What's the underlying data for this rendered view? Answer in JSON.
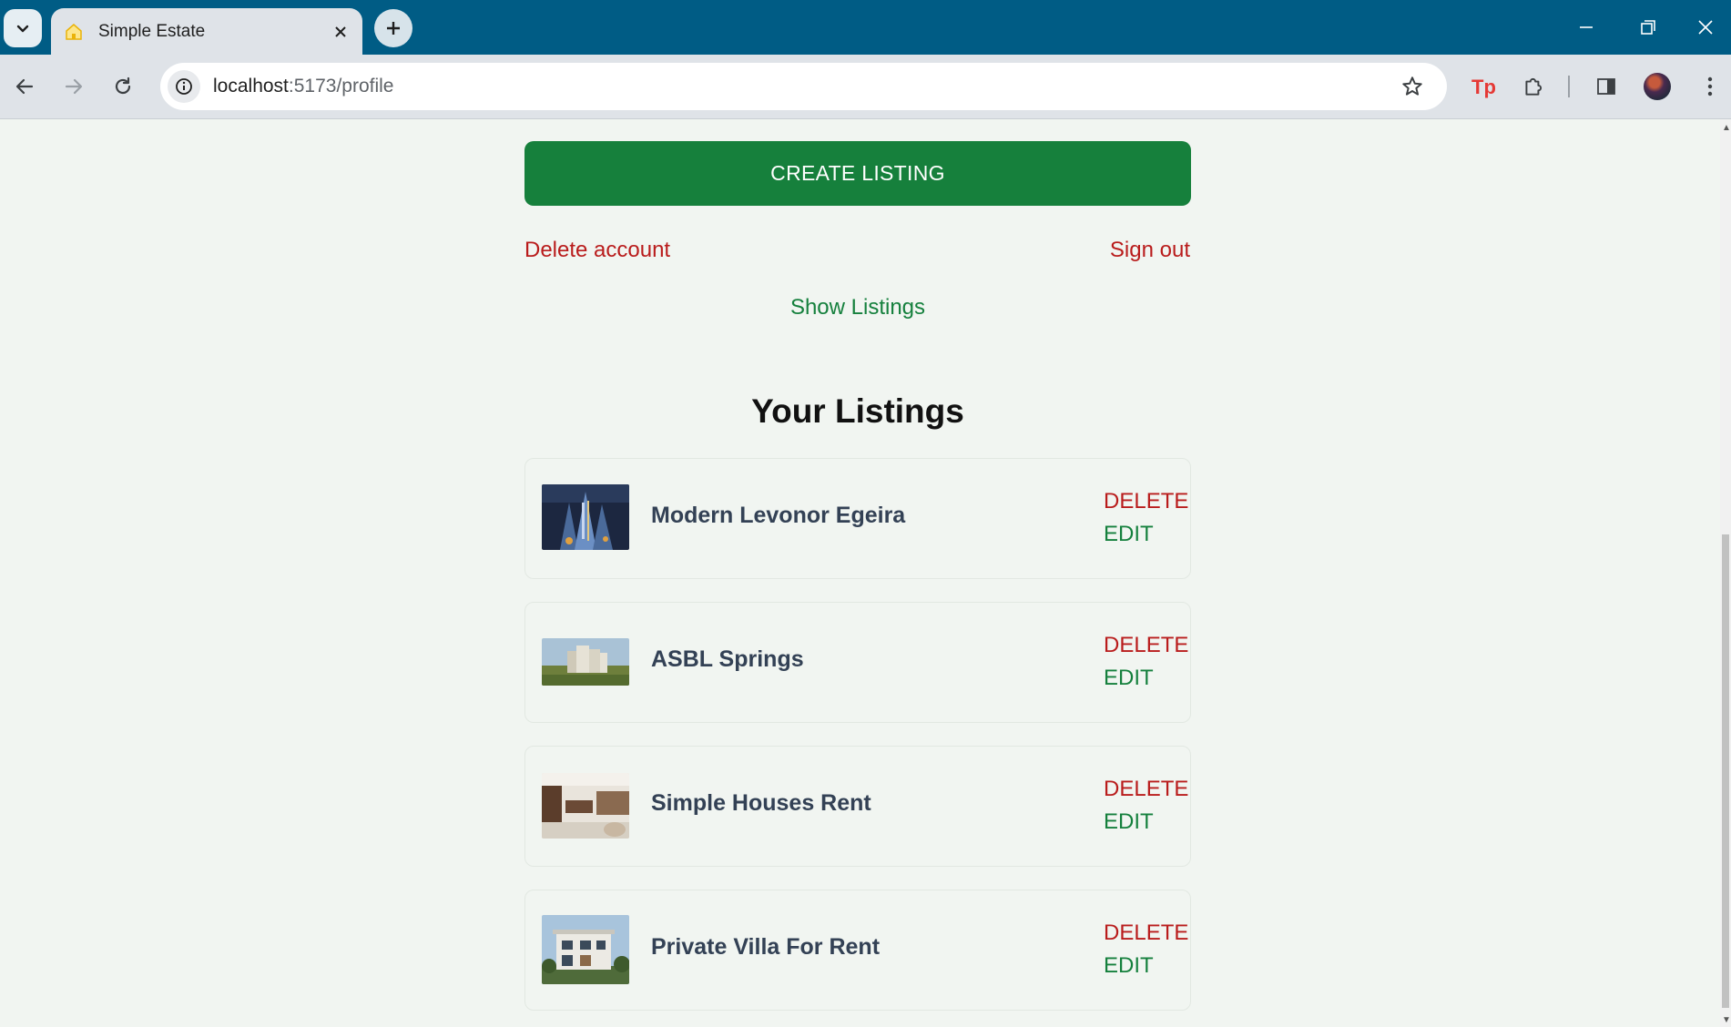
{
  "browser": {
    "tab_title": "Simple Estate",
    "url_host": "localhost",
    "url_path": ":5173/profile"
  },
  "profile": {
    "create_listing_label": "CREATE LISTING",
    "delete_account_label": "Delete account",
    "sign_out_label": "Sign out",
    "show_listings_label": "Show Listings",
    "listings_heading": "Your Listings"
  },
  "listings": [
    {
      "name": "Modern Levonor Egeira",
      "delete_label": "DELETE",
      "edit_label": "EDIT"
    },
    {
      "name": "ASBL Springs",
      "delete_label": "DELETE",
      "edit_label": "EDIT"
    },
    {
      "name": "Simple Houses Rent",
      "delete_label": "DELETE",
      "edit_label": "EDIT"
    },
    {
      "name": "Private Villa For Rent",
      "delete_label": "DELETE",
      "edit_label": "EDIT"
    }
  ],
  "colors": {
    "tabbar": "#005c85",
    "primary_green": "#16803c",
    "danger_red": "#b91c1c",
    "link_green": "#15803d",
    "page_background": "#f1f5f1"
  },
  "icons": [
    "tab-search-icon",
    "home-favicon-icon",
    "close-icon",
    "plus-icon",
    "minimize-icon",
    "restore-icon",
    "window-close-icon",
    "back-arrow-icon",
    "forward-arrow-icon",
    "reload-icon",
    "site-info-icon",
    "bookmark-star-icon",
    "tp-extension-icon",
    "extensions-puzzle-icon",
    "side-panel-icon",
    "profile-avatar-icon",
    "kebab-menu-icon"
  ]
}
